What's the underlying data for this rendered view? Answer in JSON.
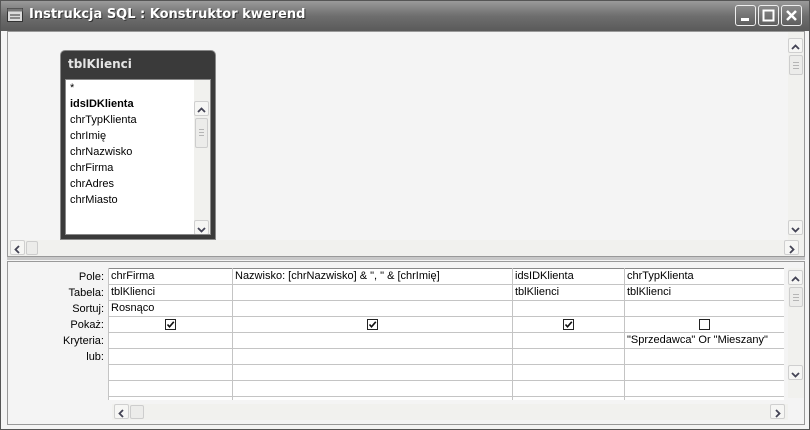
{
  "window": {
    "title": "Instrukcja SQL : Konstruktor kwerend"
  },
  "table_box": {
    "name": "tblKlienci",
    "fields": [
      "*",
      "idsIDKlienta",
      "chrTypKlienta",
      "chrImię",
      "chrNazwisko",
      "chrFirma",
      "chrAdres",
      "chrMiasto"
    ]
  },
  "grid": {
    "row_labels": {
      "pole": "Pole:",
      "tabela": "Tabela:",
      "sortuj": "Sortuj:",
      "pokaz": "Pokaż:",
      "kryteria": "Kryteria:",
      "lub": "lub:"
    },
    "columns": [
      {
        "pole": "chrFirma",
        "tabela": "tblKlienci",
        "sortuj": "Rosnąco",
        "pokaz": true,
        "kryteria": ""
      },
      {
        "pole": "Nazwisko: [chrNazwisko] & \", \" & [chrImię]",
        "tabela": "",
        "sortuj": "",
        "pokaz": true,
        "kryteria": ""
      },
      {
        "pole": "idsIDKlienta",
        "tabela": "tblKlienci",
        "sortuj": "",
        "pokaz": true,
        "kryteria": ""
      },
      {
        "pole": "chrTypKlienta",
        "tabela": "tblKlienci",
        "sortuj": "",
        "pokaz": false,
        "kryteria": "\"Sprzedawca\" Or \"Mieszany\""
      }
    ]
  }
}
